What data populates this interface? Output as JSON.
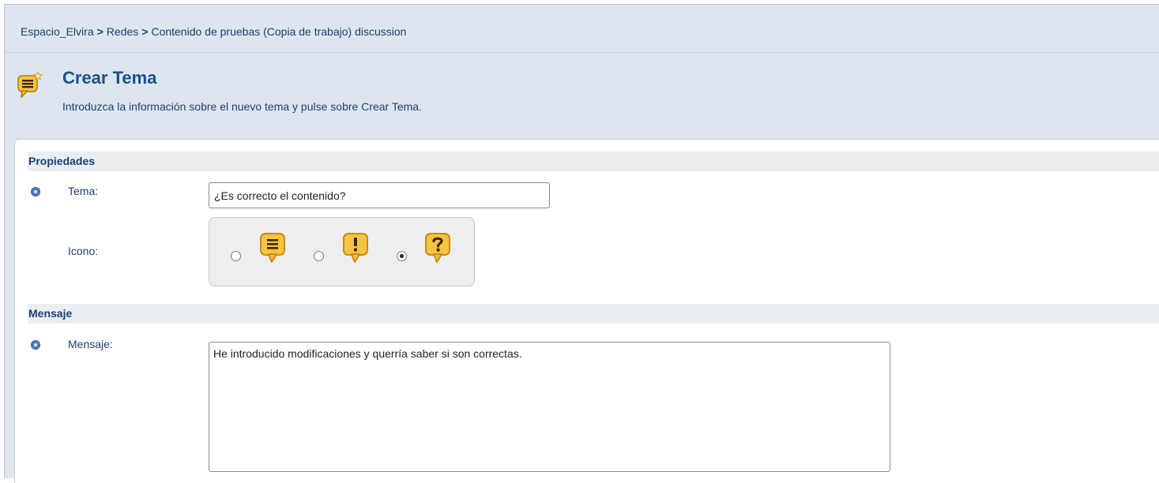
{
  "breadcrumb": {
    "items": [
      "Espacio_Elvira",
      "Redes",
      "Contenido de pruebas (Copia de trabajo) discussion"
    ],
    "separator": ">"
  },
  "header": {
    "icon": "discussion-bubble-icon",
    "title": "Crear Tema",
    "subtitle": "Introduzca la información sobre el nuevo tema y pulse sobre Crear Tema."
  },
  "properties": {
    "section_title": "Propiedades",
    "topic_label": "Tema:",
    "topic_value": "¿Es correcto el contenido?",
    "icon_label": "Icono:",
    "icon_options": [
      {
        "icon": "lines-bubble-icon",
        "selected": false
      },
      {
        "icon": "exclamation-bubble-icon",
        "selected": false
      },
      {
        "icon": "question-bubble-icon",
        "selected": true
      }
    ]
  },
  "message": {
    "section_title": "Mensaje",
    "message_label": "Mensaje:",
    "message_value": "He introducido modificaciones y querría saber si son correctas."
  },
  "colors": {
    "header_bg": "#dde6ef",
    "section_bg": "#ebeef1",
    "title": "#1b4f8a",
    "bubble_fill": "#f5c542",
    "bubble_stroke": "#c98a12"
  }
}
